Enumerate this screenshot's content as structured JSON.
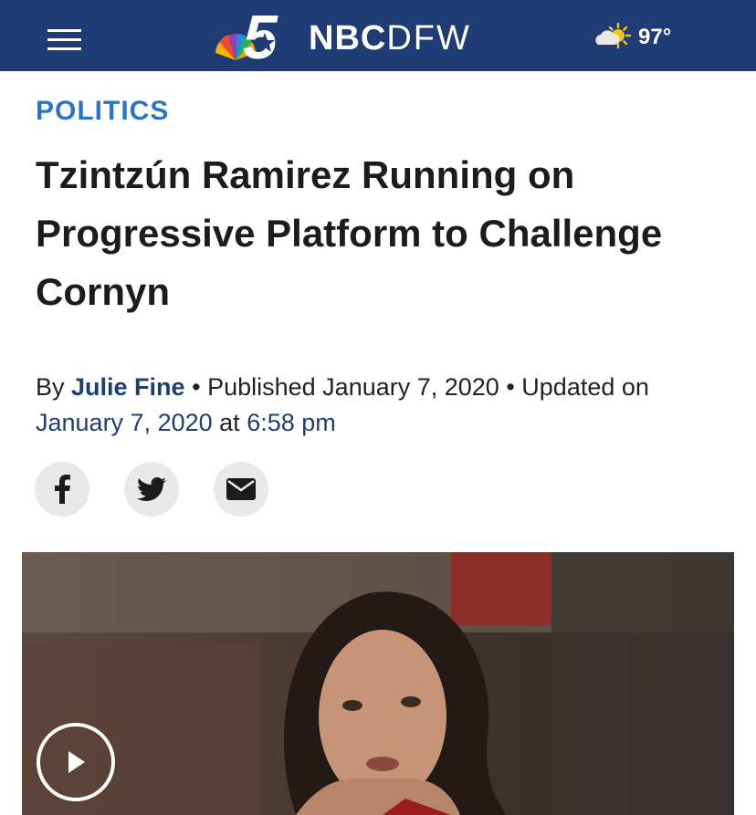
{
  "header": {
    "menu_icon": "hamburger-menu-icon",
    "logo_icon": "nbc-peacock-5-logo-icon",
    "brand_bold": "NBC",
    "brand_light": "DFW",
    "weather_icon": "partly-sunny-icon",
    "temperature": "97°",
    "background_color": "#1f3d74"
  },
  "article": {
    "category": "POLITICS",
    "headline": "Tzintzún Ramirez Running on Progressive Platform to Challenge Cornyn",
    "byline": {
      "by": "By",
      "author": "Julie Fine",
      "separator": "•",
      "published_label": "Published",
      "published_date": "January 7, 2020",
      "updated_label": "Updated on",
      "updated_date": "January 7, 2020",
      "at": "at",
      "updated_time": "6:58 pm"
    },
    "share": {
      "facebook_icon": "facebook-icon",
      "twitter_icon": "twitter-icon",
      "email_icon": "email-icon"
    },
    "video": {
      "play_icon": "play-icon"
    }
  },
  "colors": {
    "accent_blue": "#2a76c3",
    "navy": "#1f3d74"
  }
}
